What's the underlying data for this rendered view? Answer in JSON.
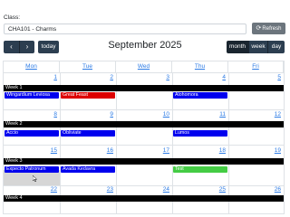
{
  "form": {
    "class_label": "Class:",
    "class_value": "CHA101 - Charms",
    "refresh_label": "Refresh",
    "refresh_icon": "refresh-icon"
  },
  "toolbar": {
    "prev": "‹",
    "next": "›",
    "today": "today",
    "title": "September 2025",
    "views": [
      "month",
      "week",
      "day"
    ],
    "active_view": "month"
  },
  "calendar": {
    "days": [
      "Mon",
      "Tue",
      "Wed",
      "Thu",
      "Fri"
    ],
    "weeks": [
      {
        "label": "Week 1",
        "dates": [
          "1",
          "2",
          "3",
          "4",
          "5"
        ]
      },
      {
        "label": "Week 2",
        "dates": [
          "8",
          "9",
          "10",
          "11",
          "12"
        ]
      },
      {
        "label": "Week 3",
        "dates": [
          "15",
          "16",
          "17",
          "18",
          "19"
        ]
      },
      {
        "label": "Week 4",
        "dates": [
          "22",
          "23",
          "24",
          "25",
          "26"
        ]
      }
    ],
    "events": [
      {
        "title": "Wingardium Leviosa",
        "week": 1,
        "day": "Mon",
        "color": "#0000ee"
      },
      {
        "title": "Great Feast",
        "week": 1,
        "day": "Tue",
        "color": "#dd0000"
      },
      {
        "title": "Alohomora",
        "week": 1,
        "day": "Thu",
        "color": "#0000ee"
      },
      {
        "title": "Accio",
        "week": 2,
        "day": "Mon",
        "color": "#0000ee"
      },
      {
        "title": "Obliviate",
        "week": 2,
        "day": "Tue",
        "color": "#0000ee"
      },
      {
        "title": "Lumos",
        "week": 2,
        "day": "Thu",
        "color": "#0000ee"
      },
      {
        "title": "Expecto Patronum",
        "week": 3,
        "day": "Mon",
        "color": "#0000ee"
      },
      {
        "title": "Avada Kedavra",
        "week": 3,
        "day": "Tue",
        "color": "#0000ee"
      },
      {
        "title": "Test",
        "week": 3,
        "day": "Thu",
        "color": "#44cc44"
      }
    ]
  },
  "colors": {
    "button_dark": "#2c3e50",
    "link_blue": "#2c7be5",
    "week_bar": "#000000",
    "highlight": "#d6d6d6"
  }
}
